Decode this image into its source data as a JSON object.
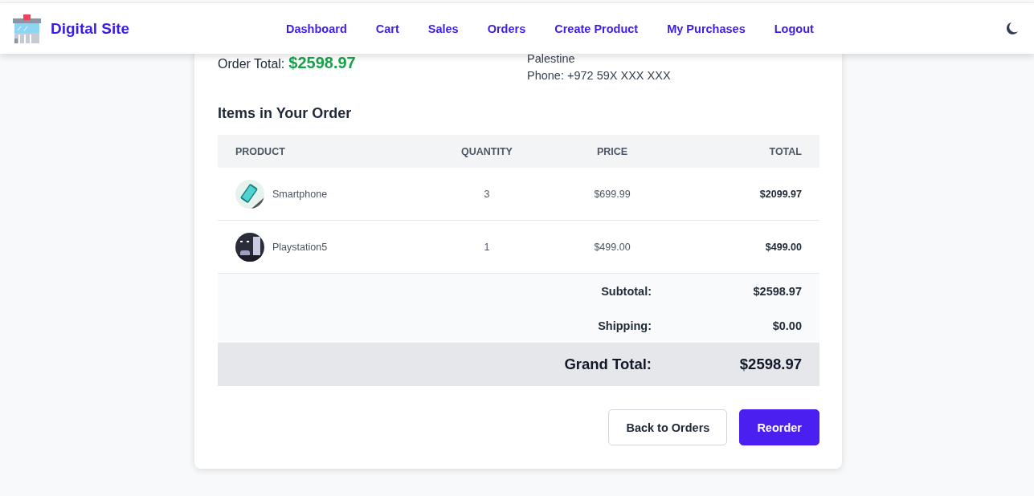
{
  "navbar": {
    "brand": "Digital Site",
    "links": [
      {
        "label": "Dashboard"
      },
      {
        "label": "Cart"
      },
      {
        "label": "Sales"
      },
      {
        "label": "Orders"
      },
      {
        "label": "Create Product"
      },
      {
        "label": "My Purchases"
      },
      {
        "label": "Logout"
      }
    ]
  },
  "order": {
    "total_label": "Order Total:",
    "total_value": "$2598.97",
    "address_lines": [
      "Palestine",
      "Phone: +972 59X XXX XXX"
    ]
  },
  "items_title": "Items in Your Order",
  "table": {
    "columns": [
      "PRODUCT",
      "QUANTITY",
      "PRICE",
      "TOTAL"
    ],
    "rows": [
      {
        "product": "Smartphone",
        "quantity": "3",
        "price": "$699.99",
        "total": "$2099.97"
      },
      {
        "product": "Playstation5",
        "quantity": "1",
        "price": "$499.00",
        "total": "$499.00"
      }
    ],
    "summary": [
      {
        "kind": "normal",
        "label": "Subtotal:",
        "value": "$2598.97"
      },
      {
        "kind": "normal",
        "label": "Shipping:",
        "value": "$0.00"
      },
      {
        "kind": "grand",
        "label": "Grand Total:",
        "value": "$2598.97"
      }
    ]
  },
  "buttons": [
    {
      "label": "Back to Orders",
      "kind": "secondary"
    },
    {
      "label": "Reorder",
      "kind": "primary"
    }
  ]
}
